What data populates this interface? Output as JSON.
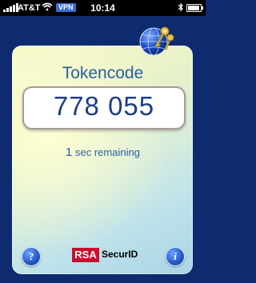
{
  "status_bar": {
    "carrier": "AT&T",
    "vpn": "VPN",
    "time": "10:14",
    "battery_fraction": 0.95
  },
  "app": {
    "title": "Tokencode",
    "tokencode": "778 055",
    "remaining_seconds": "1",
    "remaining_text": "sec remaining",
    "brand_rsa": "RSA",
    "brand_product": "SecurID",
    "help_label": "?",
    "info_label": "i"
  },
  "colors": {
    "background": "#0d2b6e",
    "accent_text": "#2b5fa2",
    "token_text": "#1c3e86",
    "rsa_red": "#c8102e"
  },
  "icons": {
    "globe": "globe-with-keys-icon",
    "help": "question-mark-icon",
    "info": "info-icon"
  }
}
